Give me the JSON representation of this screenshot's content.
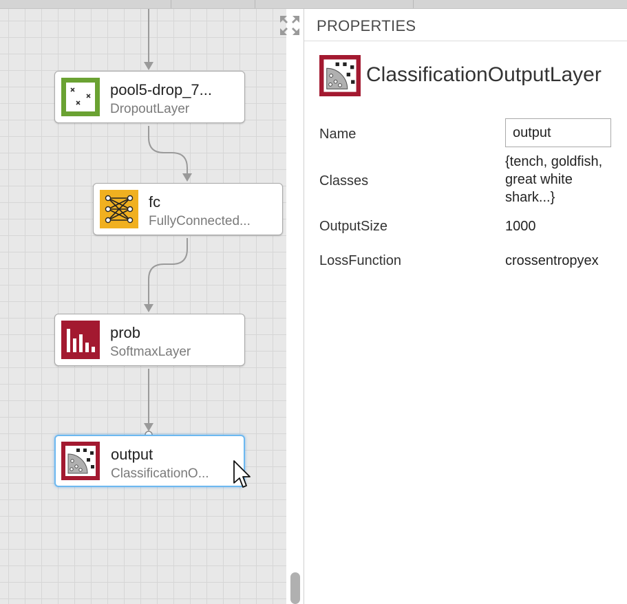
{
  "panel": {
    "title": "PROPERTIES"
  },
  "layers": [
    {
      "name": "pool5-drop_7...",
      "type": "DropoutLayer",
      "icon": "dropout-icon",
      "color": "#6aa232"
    },
    {
      "name": "fc",
      "type": "FullyConnected...",
      "icon": "fully-connected-icon",
      "color": "#f0b020"
    },
    {
      "name": "prob",
      "type": "SoftmaxLayer",
      "icon": "softmax-icon",
      "color": "#a31930"
    },
    {
      "name": "output",
      "type": "ClassificationO...",
      "icon": "classification-icon",
      "color": "#a31930",
      "selected": true
    }
  ],
  "selected_layer": {
    "type": "ClassificationOutputLayer",
    "properties": {
      "name_label": "Name",
      "name_value": "output",
      "classes_label": "Classes",
      "classes_value": "{tench, goldfish, great white shark...}",
      "output_size_label": "OutputSize",
      "output_size_value": "1000",
      "loss_label": "LossFunction",
      "loss_value": "crossentropyex"
    }
  },
  "colors": {
    "canvas_bg": "#e8e8e8",
    "selection": "#6cb8f0",
    "dropout": "#6aa232",
    "fully_connected": "#f0b020",
    "output": "#a31930"
  }
}
